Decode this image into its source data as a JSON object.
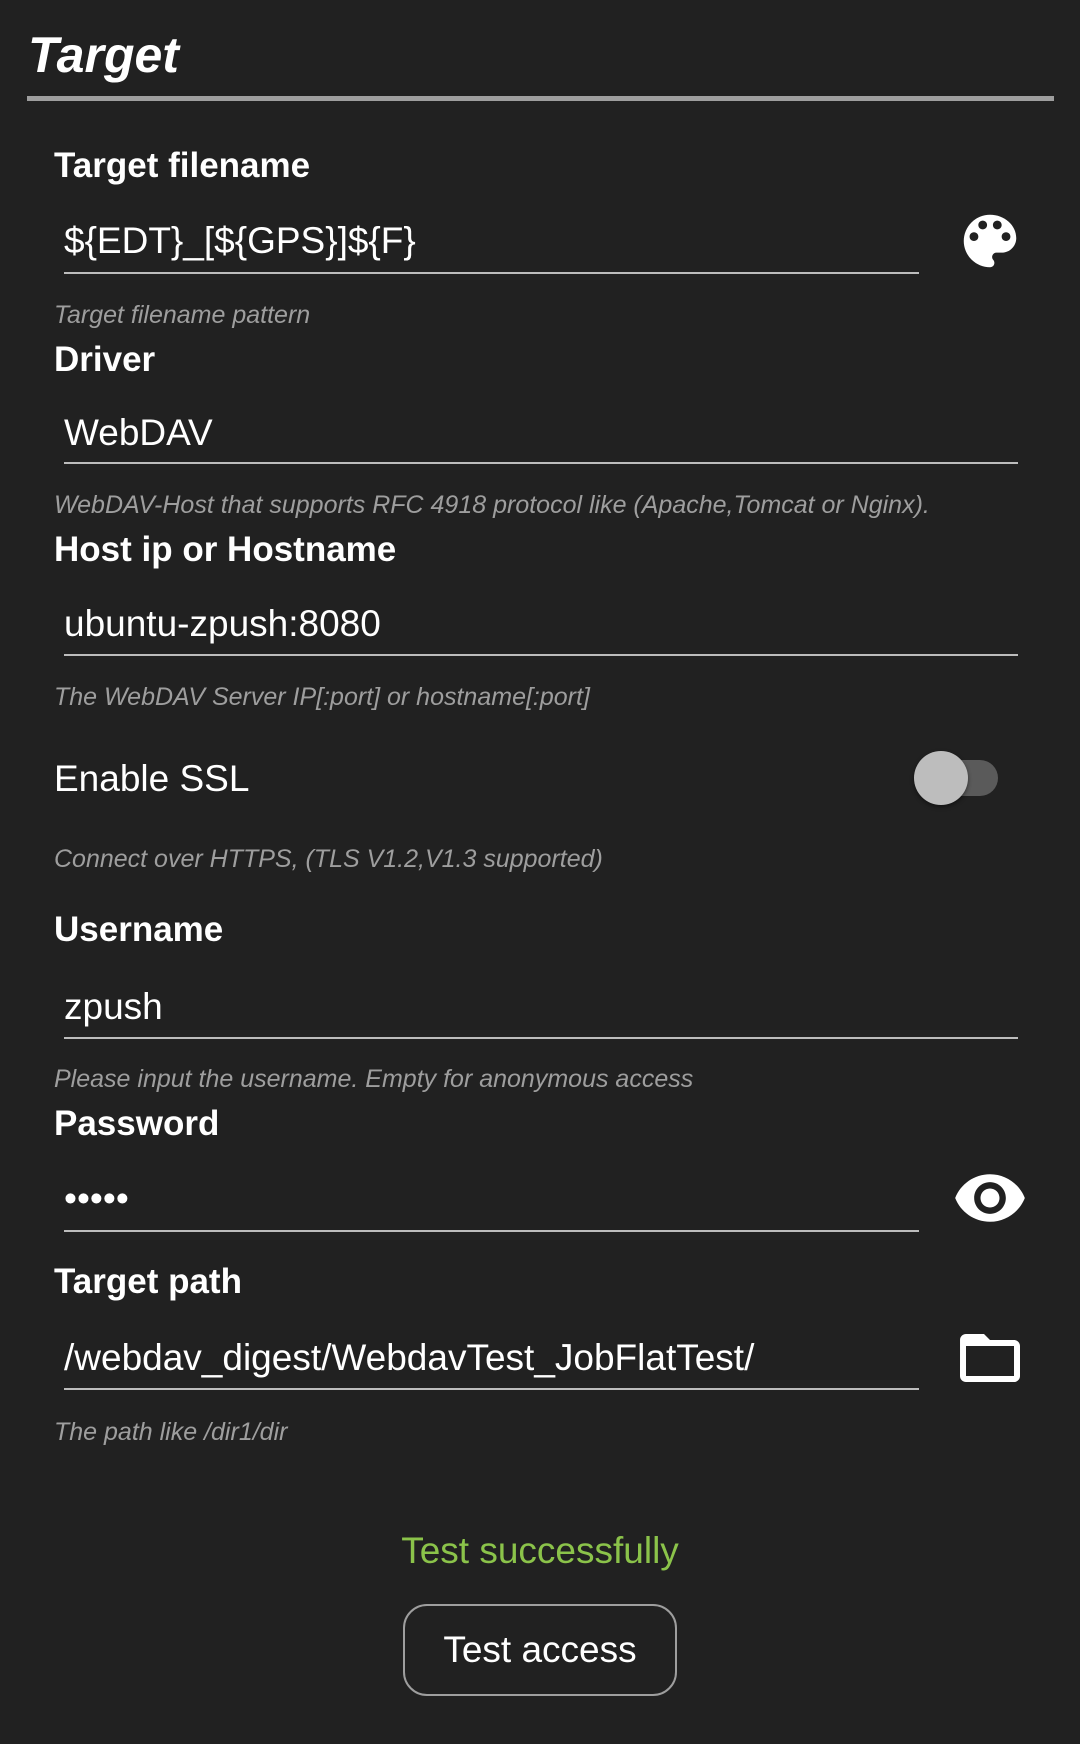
{
  "section": {
    "title": "Target"
  },
  "fields": {
    "target_filename": {
      "label": "Target filename",
      "value": "${EDT}_[${GPS}]${F}",
      "hint": "Target filename pattern"
    },
    "driver": {
      "label": "Driver",
      "value": "WebDAV",
      "hint": "WebDAV-Host that supports RFC 4918 protocol like (Apache,Tomcat or Nginx)."
    },
    "host": {
      "label": "Host ip or Hostname",
      "value": "ubuntu-zpush:8080",
      "hint": "The WebDAV Server IP[:port] or hostname[:port]"
    },
    "ssl": {
      "label": "Enable SSL",
      "enabled": false,
      "hint": "Connect over HTTPS, (TLS V1.2,V1.3 supported)"
    },
    "username": {
      "label": "Username",
      "value": "zpush",
      "hint": "Please input the username. Empty for anonymous access"
    },
    "password": {
      "label": "Password",
      "value": "•••••"
    },
    "target_path": {
      "label": "Target path",
      "value": "/webdav_digest/WebdavTest_JobFlatTest/",
      "hint": "The path like /dir1/dir"
    }
  },
  "icons": {
    "palette": "palette-icon",
    "eye": "eye-icon",
    "folder": "folder-icon"
  },
  "status": {
    "text": "Test successfully"
  },
  "actions": {
    "test_label": "Test access"
  },
  "colors": {
    "background": "#212121",
    "success": "#8bc34a",
    "hint": "#9e9e9e",
    "divider": "#9e9e9e"
  }
}
